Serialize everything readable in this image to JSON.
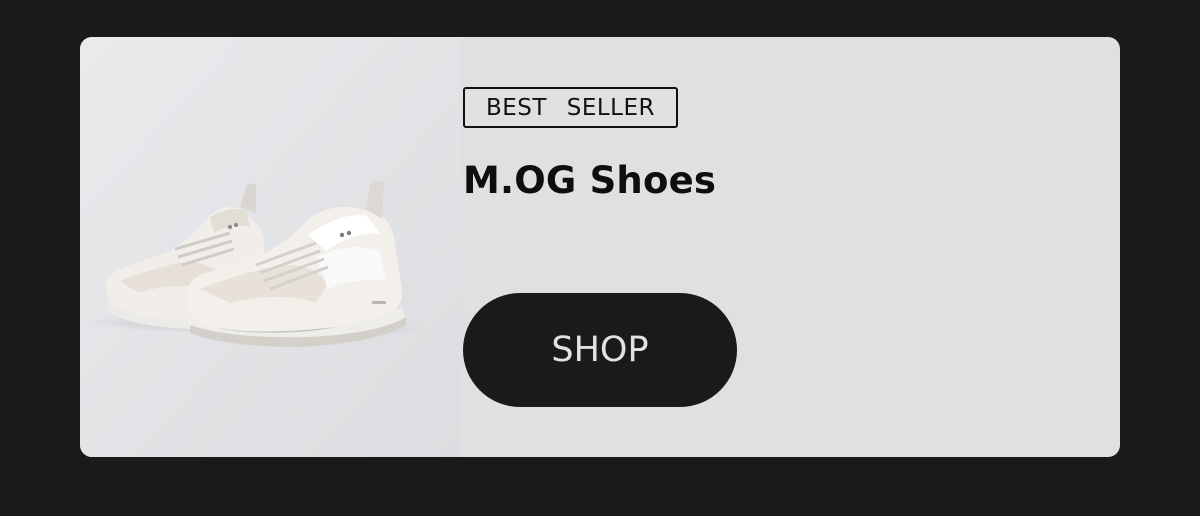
{
  "product": {
    "badge": "BEST SELLER",
    "name": "M.OG Shoes",
    "cta_label": "SHOP",
    "image_icon": "sneaker-pair-image"
  },
  "colors": {
    "page_background": "#1a1a1a",
    "card_background": "#dfe0e2",
    "button_background": "#1a1a1a",
    "button_text": "#e2e2e2",
    "text": "#0e0e0e"
  }
}
